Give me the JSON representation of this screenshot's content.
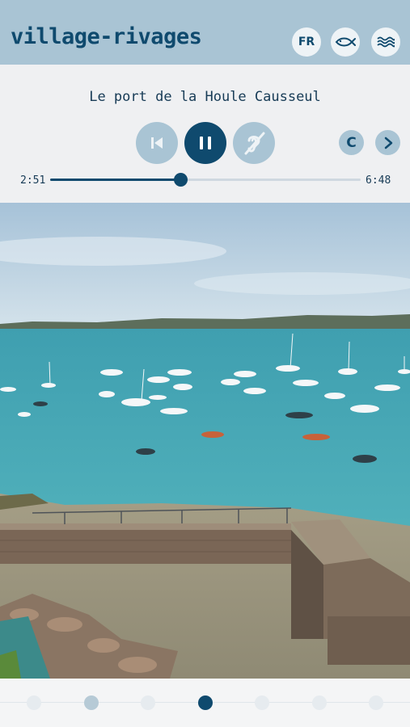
{
  "header": {
    "brand": "village-rivages",
    "language_label": "FR",
    "buttons": [
      "fish-icon",
      "waves-icon"
    ]
  },
  "player": {
    "title": "Le port de la Houle Causseul",
    "elapsed": "2:51",
    "total": "6:48",
    "progress_fraction": 0.42,
    "c_label": "C",
    "controls": [
      "previous-track-icon",
      "pause-icon",
      "hearing-accessibility-icon",
      "chevron-right-icon"
    ]
  },
  "pager": {
    "count": 7,
    "active_index": 3,
    "visited_indices": [
      1
    ]
  },
  "colors": {
    "brand": "#0f4a6e",
    "header_bg": "#a9c4d4",
    "panel_bg": "#eff0f2"
  }
}
